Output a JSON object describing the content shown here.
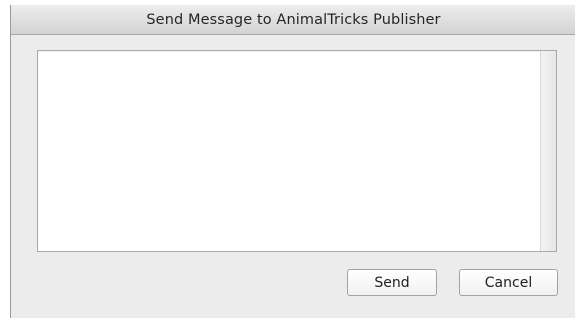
{
  "window": {
    "title": "Send Message to AnimalTricks Publisher"
  },
  "message": {
    "value": "",
    "placeholder": ""
  },
  "buttons": {
    "send_label": "Send",
    "cancel_label": "Cancel"
  }
}
